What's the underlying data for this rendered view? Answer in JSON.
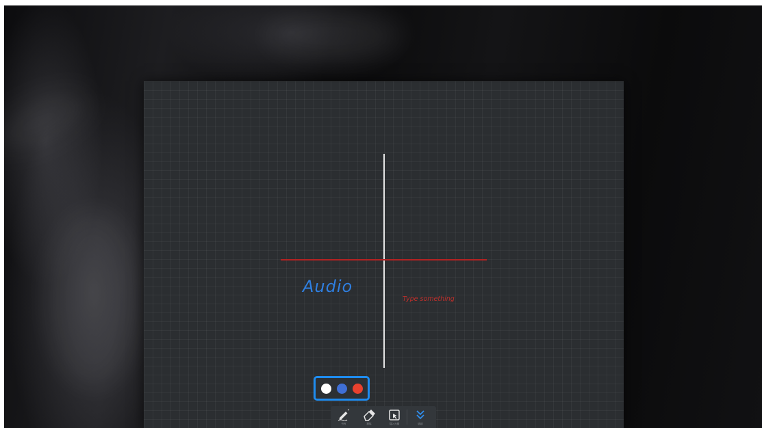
{
  "whiteboard": {
    "ink_text_primary": "Audio",
    "ink_text_secondary": "Type something",
    "ink_colors": {
      "vertical_stroke": "#e7e7e7",
      "horizontal_stroke": "#b42222",
      "primary_text": "#2f7fe0",
      "secondary_text": "#c0302c"
    }
  },
  "palette": {
    "colors": [
      {
        "name": "white",
        "hex": "#ffffff"
      },
      {
        "name": "blue",
        "hex": "#3f6fd6"
      },
      {
        "name": "red",
        "hex": "#e8412e"
      }
    ],
    "highlight_color": "#1e8cf0"
  },
  "toolbar": {
    "tools": [
      {
        "id": "pen",
        "label": "书写",
        "icon": "pen-icon",
        "active": true
      },
      {
        "id": "eraser",
        "label": "擦除",
        "icon": "eraser-icon"
      },
      {
        "id": "select",
        "label": "插入元素",
        "icon": "select-icon"
      },
      {
        "id": "collapse",
        "label": "收起",
        "icon": "chevron-down-icon"
      }
    ]
  }
}
